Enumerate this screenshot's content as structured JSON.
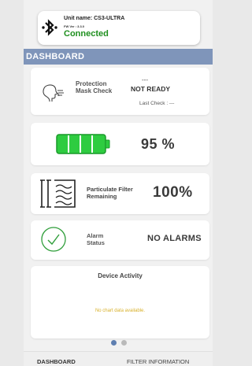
{
  "device": {
    "unit_name": "Unit name: CS3-ULTRA",
    "fw_version": "FW Ver : 3.3.0",
    "status": "Connected",
    "status_color": "#1e8f1e",
    "icon": "bluetooth-icon"
  },
  "header": {
    "title": "DASHBOARD",
    "color": "#7f95ba"
  },
  "protection": {
    "label": "Protection Mask Check",
    "status_top": "---",
    "status": "NOT READY",
    "last_check": "Last Check : ---",
    "icon": "mask-breath-icon"
  },
  "battery": {
    "value": "95 %",
    "level": 0.95,
    "icon": "battery-icon",
    "color": "#2ecc40"
  },
  "filter": {
    "label": "Particulate Filter Remaining",
    "value": "100%",
    "level": 1.0,
    "icon": "filter-icon"
  },
  "alarm": {
    "label": "Alarm Status",
    "value": "NO ALARMS",
    "icon": "check-circle-icon",
    "icon_color": "#2f9e3a"
  },
  "activity": {
    "title": "Device Activity",
    "empty_text": "No chart data available.",
    "empty_color": "#d8b02a"
  },
  "pager": {
    "pages": 2,
    "current": 1
  },
  "tabs": [
    {
      "label": "DASHBOARD"
    },
    {
      "label": "FILTER INFORMATION"
    }
  ]
}
